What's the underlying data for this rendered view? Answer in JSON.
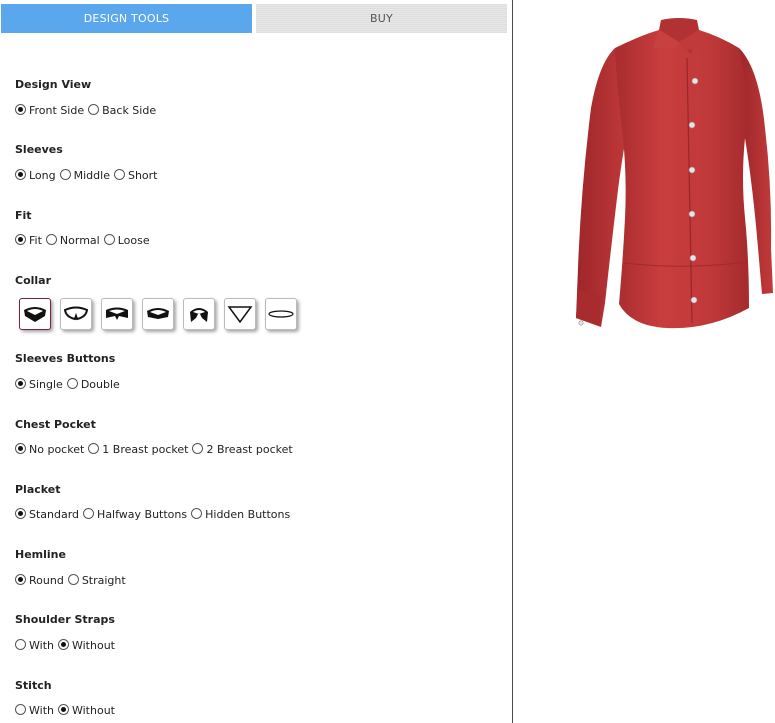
{
  "tabs": {
    "design": "DESIGN TOOLS",
    "buy": "BUY"
  },
  "sections": [
    {
      "title": "Design View",
      "options": [
        {
          "label": "Front Side",
          "checked": true
        },
        {
          "label": "Back Side",
          "checked": false
        }
      ]
    },
    {
      "title": "Sleeves",
      "options": [
        {
          "label": "Long",
          "checked": true
        },
        {
          "label": "Middle",
          "checked": false
        },
        {
          "label": "Short",
          "checked": false
        }
      ]
    },
    {
      "title": "Fit",
      "options": [
        {
          "label": "Fit",
          "checked": true
        },
        {
          "label": "Normal",
          "checked": false
        },
        {
          "label": "Loose",
          "checked": false
        }
      ]
    },
    {
      "title": "Collar"
    },
    {
      "title": "Sleeves Buttons",
      "options": [
        {
          "label": "Single",
          "checked": true
        },
        {
          "label": "Double",
          "checked": false
        }
      ]
    },
    {
      "title": "Chest Pocket",
      "options": [
        {
          "label": "No pocket",
          "checked": true
        },
        {
          "label": "1 Breast pocket",
          "checked": false
        },
        {
          "label": "2 Breast pocket",
          "checked": false
        }
      ]
    },
    {
      "title": "Placket",
      "options": [
        {
          "label": "Standard",
          "checked": true
        },
        {
          "label": "Halfway Buttons",
          "checked": false
        },
        {
          "label": "Hidden Buttons",
          "checked": false
        }
      ]
    },
    {
      "title": "Hemline",
      "options": [
        {
          "label": "Round",
          "checked": true
        },
        {
          "label": "Straight",
          "checked": false
        }
      ]
    },
    {
      "title": "Shoulder Straps",
      "options": [
        {
          "label": "With",
          "checked": false
        },
        {
          "label": "Without",
          "checked": true
        }
      ]
    },
    {
      "title": "Stitch",
      "options": [
        {
          "label": "With",
          "checked": false
        },
        {
          "label": "Without",
          "checked": true
        }
      ]
    }
  ],
  "collar_icons": [
    "collar-classic-icon",
    "collar-rounded-icon",
    "collar-spread-icon",
    "collar-button-down-icon",
    "collar-mandarin-icon",
    "collar-v-neck-icon",
    "collar-round-neck-icon"
  ],
  "colors": {
    "tab_active": "#5aa7ee",
    "shirt": "#c0393a"
  }
}
